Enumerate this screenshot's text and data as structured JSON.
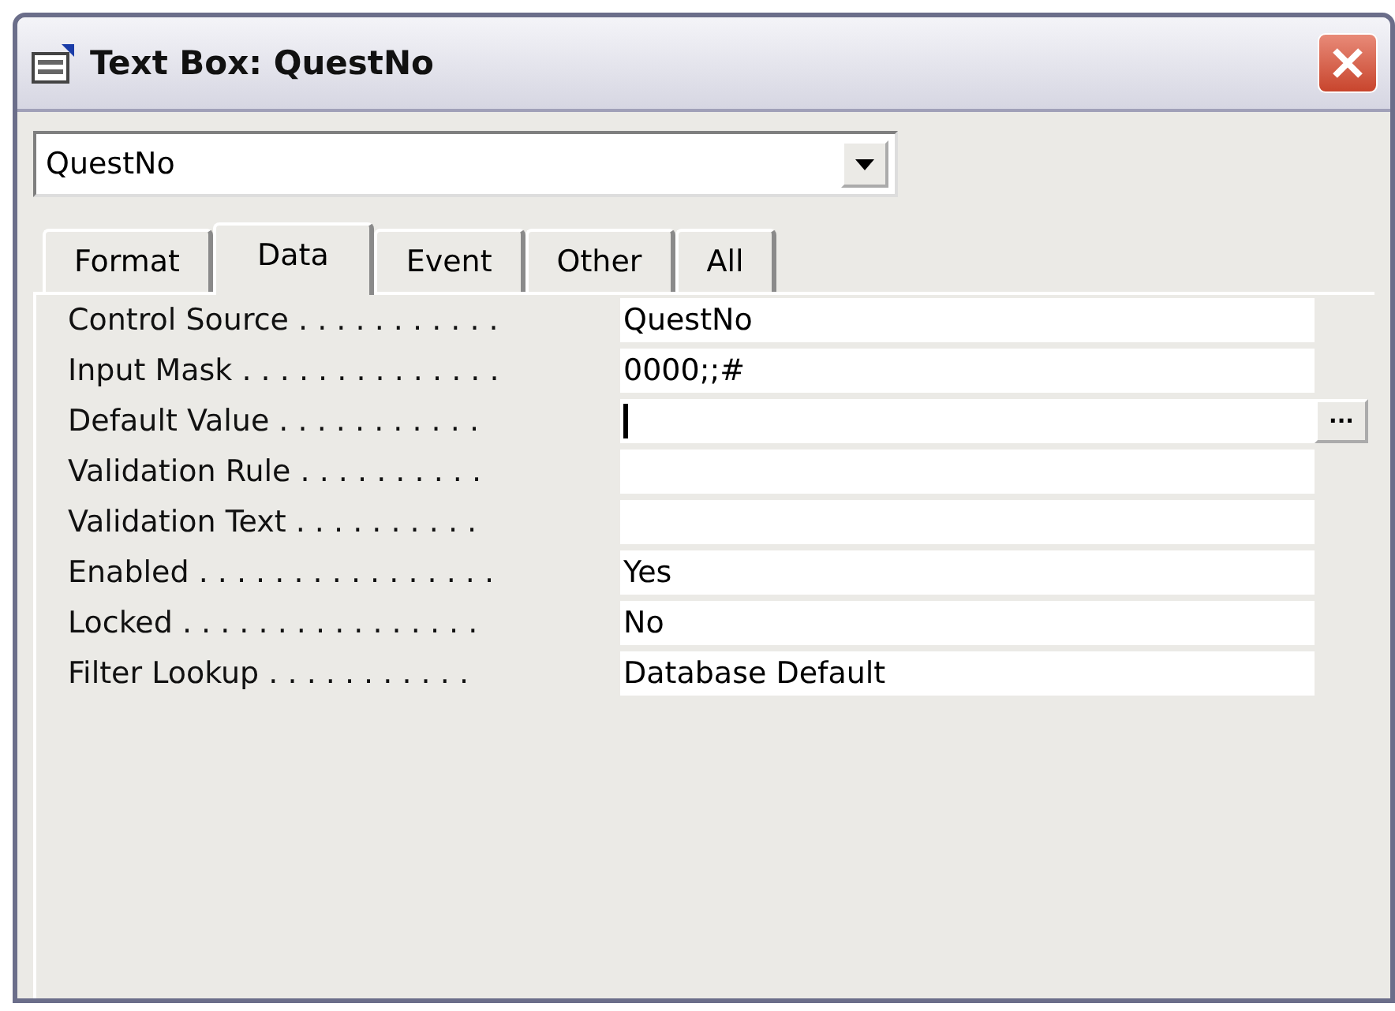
{
  "window": {
    "title": "Text Box: QuestNo"
  },
  "object_selector": {
    "value": "QuestNo"
  },
  "tabs": [
    {
      "label": "Format",
      "selected": false
    },
    {
      "label": "Data",
      "selected": true
    },
    {
      "label": "Event",
      "selected": false
    },
    {
      "label": "Other",
      "selected": false
    },
    {
      "label": "All",
      "selected": false
    }
  ],
  "properties": [
    {
      "label": "Control Source . . . . . . . . . . .",
      "value": "QuestNo",
      "focused": false
    },
    {
      "label": "Input Mask . . . . . . . . . . . . . .",
      "value": "0000;;#",
      "focused": false
    },
    {
      "label": "Default Value . . . . . . . . . . .",
      "focused": true,
      "builder": "..."
    },
    {
      "label": "Validation Rule . . . . . . . . . .",
      "focused": false
    },
    {
      "label": "Validation Text . . . . . . . . . .",
      "focused": false
    },
    {
      "label": "Enabled . . . . . . . . . . . . . . . .",
      "value": "Yes",
      "focused": false
    },
    {
      "label": "Locked . . . . . . . . . . . . . . . .",
      "value": "No",
      "focused": false
    },
    {
      "label": "Filter Lookup . . . . . . . . . . .",
      "value": "Database Default",
      "focused": false
    }
  ]
}
